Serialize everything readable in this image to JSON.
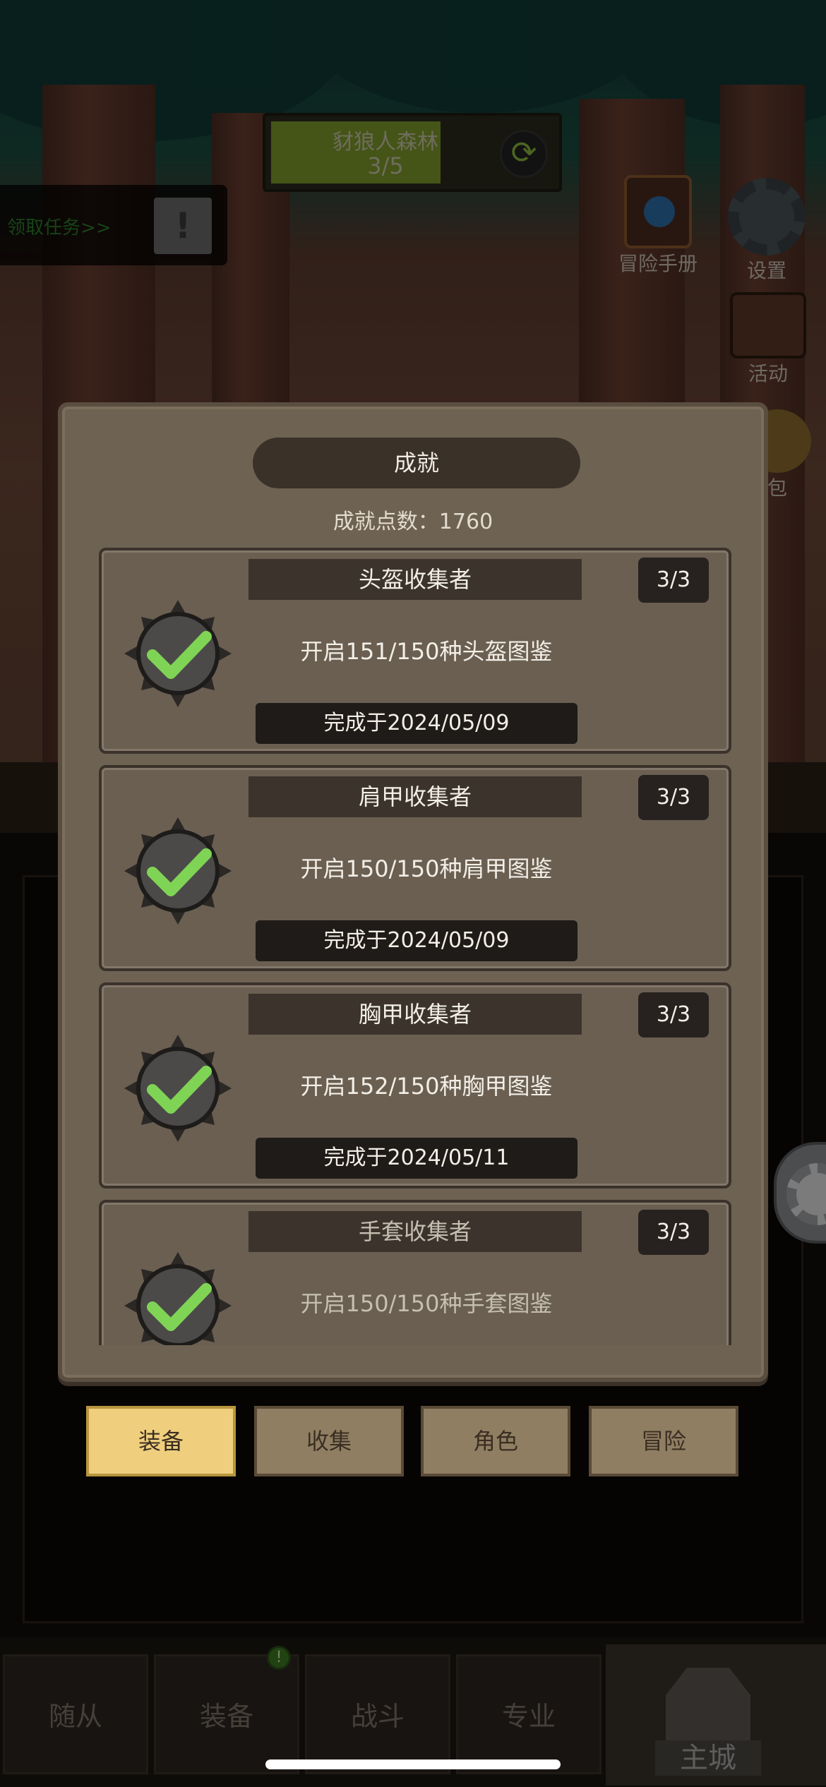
{
  "zone": {
    "name": "豺狼人森林",
    "progress": "3/5",
    "progress_fraction": 0.6
  },
  "quest": {
    "label": "领取任务>>",
    "icon": "exclamation-icon"
  },
  "side_buttons": [
    {
      "label": "冒险手册",
      "icon": "book-icon"
    },
    {
      "label": "设置",
      "icon": "gear-icon"
    },
    {
      "label": "活动",
      "icon": "calendar-icon"
    },
    {
      "label": "包",
      "icon": "bag-icon"
    }
  ],
  "panel": {
    "title": "成就",
    "points_text": "成就点数：1760",
    "achievements": [
      {
        "name": "头盔收集者",
        "progress": "3/3",
        "desc": "开启151/150种头盔图鉴",
        "date": "完成于2024/05/09",
        "icon": "check-badge-icon"
      },
      {
        "name": "肩甲收集者",
        "progress": "3/3",
        "desc": "开启150/150种肩甲图鉴",
        "date": "完成于2024/05/09",
        "icon": "check-badge-icon"
      },
      {
        "name": "胸甲收集者",
        "progress": "3/3",
        "desc": "开启152/150种胸甲图鉴",
        "date": "完成于2024/05/11",
        "icon": "check-badge-icon"
      },
      {
        "name": "手套收集者",
        "progress": "3/3",
        "desc": "开启150/150种手套图鉴",
        "date": "",
        "icon": "check-badge-icon"
      }
    ],
    "tabs": [
      {
        "label": "装备",
        "active": true
      },
      {
        "label": "收集",
        "active": false
      },
      {
        "label": "角色",
        "active": false
      },
      {
        "label": "冒险",
        "active": false
      }
    ]
  },
  "bottom_nav": {
    "tabs": [
      "随从",
      "装备",
      "战斗",
      "专业"
    ],
    "badge": "!",
    "main": "主城"
  },
  "colors": {
    "accent_tab": "#efcf7d",
    "check_green": "#7fd455",
    "panel_bg": "#6e6252"
  }
}
